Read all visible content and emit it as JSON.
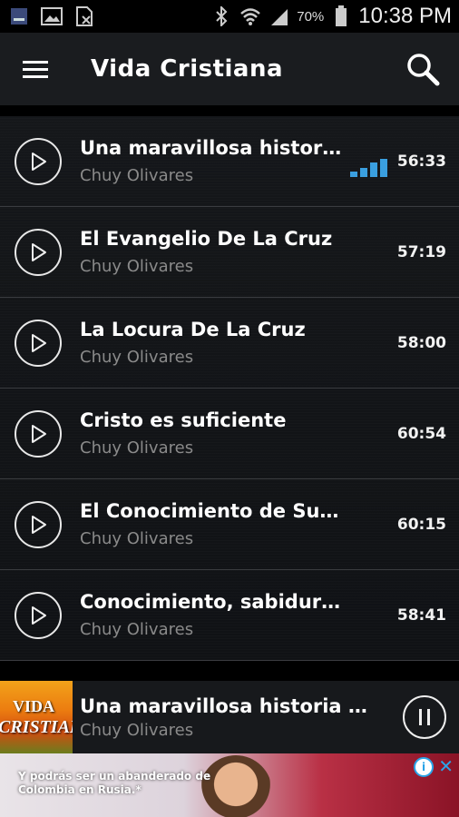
{
  "status_bar": {
    "battery_text": "70%",
    "time": "10:38 PM",
    "icons": [
      "app-notification-icon",
      "image-icon",
      "file-blocked-icon",
      "bluetooth-icon",
      "wifi-icon",
      "signal-icon",
      "battery-icon"
    ]
  },
  "app_bar": {
    "title": "Vida Cristiana",
    "menu_icon": "hamburger-menu-icon",
    "search_icon": "search-icon"
  },
  "episodes": [
    {
      "title": "Una maravillosa histor…",
      "artist": "Chuy Olivares",
      "duration": "56:33",
      "playing": true
    },
    {
      "title": "El Evangelio De La Cruz",
      "artist": "Chuy Olivares",
      "duration": "57:19",
      "playing": false
    },
    {
      "title": "La Locura De La Cruz",
      "artist": "Chuy Olivares",
      "duration": "58:00",
      "playing": false
    },
    {
      "title": "Cristo es suficiente",
      "artist": "Chuy Olivares",
      "duration": "60:54",
      "playing": false
    },
    {
      "title": "El Conocimiento de Su…",
      "artist": "Chuy Olivares",
      "duration": "60:15",
      "playing": false
    },
    {
      "title": "Conocimiento, sabiduria e…",
      "artist": "Chuy Olivares",
      "duration": "58:41",
      "playing": false
    }
  ],
  "now_playing": {
    "art_line1": "VIDA",
    "art_line2": "CRISTIANA",
    "title": "Una maravillosa historia de..",
    "artist": "Chuy Olivares"
  },
  "ad": {
    "text": "Y podrás ser un abanderado de Colombia en Rusia.*",
    "info_label": "i",
    "close_label": "✕"
  },
  "colors": {
    "accent": "#3a9fe0",
    "background": "#121417",
    "app_bar": "#1a1c1f",
    "secondary_text": "#8a8a8a"
  }
}
